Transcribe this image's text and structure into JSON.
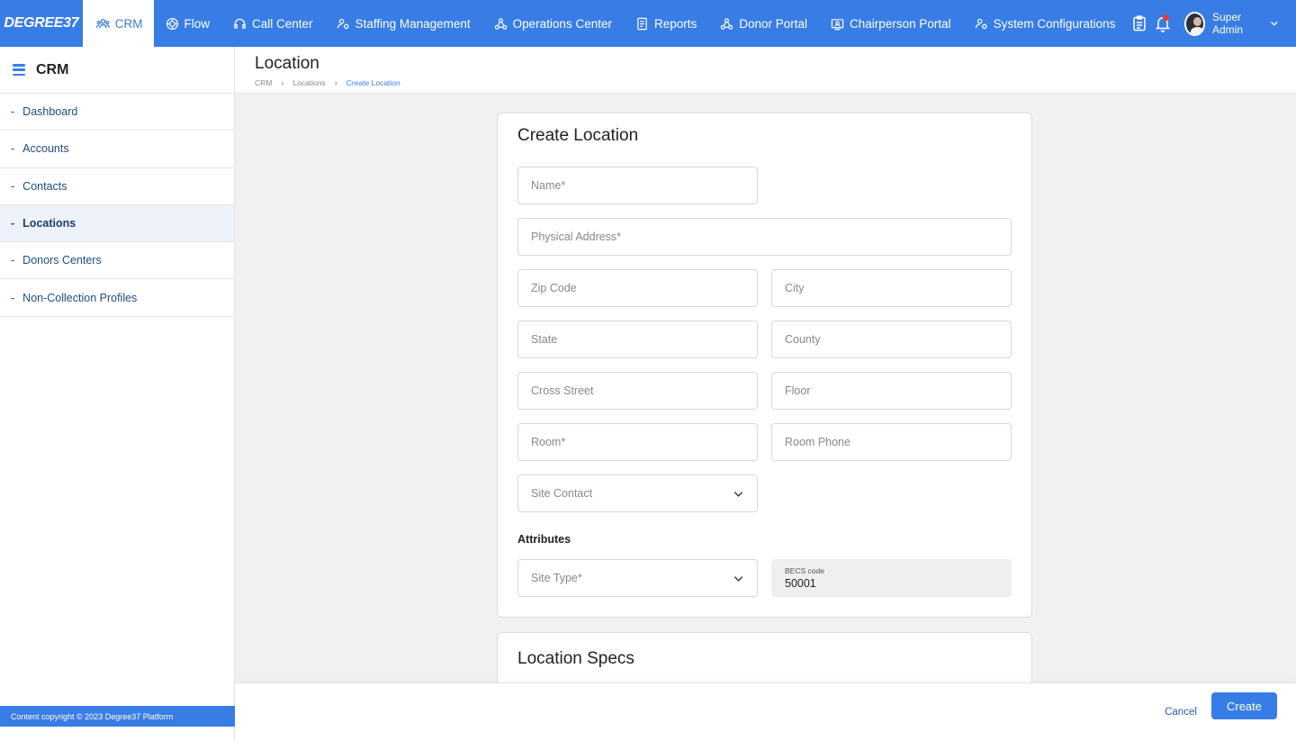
{
  "brand": {
    "logo": "DEGREE37"
  },
  "nav": {
    "items": [
      {
        "label": "CRM",
        "icon": "users-icon",
        "active": true
      },
      {
        "label": "Flow",
        "icon": "flow-icon",
        "active": false
      },
      {
        "label": "Call Center",
        "icon": "headset-icon",
        "active": false
      },
      {
        "label": "Staffing Management",
        "icon": "staff-settings-icon",
        "active": false
      },
      {
        "label": "Operations Center",
        "icon": "network-icon",
        "active": false
      },
      {
        "label": "Reports",
        "icon": "report-icon",
        "active": false
      },
      {
        "label": "Donor Portal",
        "icon": "network-icon",
        "active": false
      },
      {
        "label": "Chairperson Portal",
        "icon": "id-card-icon",
        "active": false
      },
      {
        "label": "System Configurations",
        "icon": "user-gear-icon",
        "active": false
      }
    ],
    "user_name": "Super Admin"
  },
  "sidebar": {
    "title": "CRM",
    "items": [
      {
        "label": "Dashboard",
        "active": false
      },
      {
        "label": "Accounts",
        "active": false
      },
      {
        "label": "Contacts",
        "active": false
      },
      {
        "label": "Locations",
        "active": true
      },
      {
        "label": "Donors Centers",
        "active": false
      },
      {
        "label": "Non-Collection Profiles",
        "active": false
      }
    ],
    "footer": "Content copyright © 2023 Degree37 Platform"
  },
  "header": {
    "title": "Location",
    "breadcrumb": [
      "CRM",
      "Locations",
      "Create Location"
    ]
  },
  "form": {
    "title": "Create Location",
    "fields": {
      "name": "Name*",
      "physical_address": "Physical Address*",
      "zip_code": "Zip Code",
      "city": "City",
      "state": "State",
      "county": "County",
      "cross_street": "Cross Street",
      "floor": "Floor",
      "room": "Room*",
      "room_phone": "Room Phone",
      "site_contact": "Site Contact"
    },
    "attributes_label": "Attributes",
    "site_type": "Site Type*",
    "becs_label": "BECS code",
    "becs_value": "50001"
  },
  "specs": {
    "title": "Location Specs"
  },
  "actions": {
    "cancel": "Cancel",
    "create": "Create"
  },
  "colors": {
    "primary": "#387de5",
    "active_sidebar_bg": "#eef3fb"
  }
}
